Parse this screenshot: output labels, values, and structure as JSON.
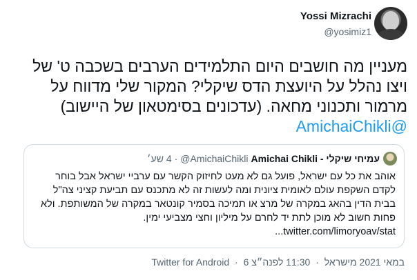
{
  "author": {
    "name": "Yossi Mizrachi",
    "handle": "@yosimiz1"
  },
  "tweet": {
    "text": "מעניין מה חושבים היום התלמידים הערבים בשכבה ט' של ויצו נהלל על היועצת הדס שיקלי? המקור שלי מדווח על מרמור ותכנוני מחאה. (עדכונים בסימטאון של היישוב)",
    "mention": "@AmichaiChikli"
  },
  "quote": {
    "name": "עמיחי שיקלי - Amichai Chikli",
    "handle": "@AmichaiChikli",
    "time": "4 שע׳",
    "text": "אוהב את כל עם ישראל, פועל גם לא מעט לחיזוק הקשר עם ערביי ישראל אבל בוחר לקדם השקפת עולם לאומית ציונית ומה לעשות זה לא מתכנס עם תביעת קציני צה\"ל בבית הדין בהאג במקרה של מרצ או תמיכה בסמיר קונטאר במקרה של המשותפת. ולא פחות חשוב לא מוכן לתת יד לחרם על מיליון וחצי מצביעי ימין.",
    "link": "twitter.com/limoryoav/stat..."
  },
  "meta": {
    "time": "11:30 לפנה״צ",
    "date": "6 במאי 2021 מישראל",
    "source": "Twitter for Android"
  }
}
